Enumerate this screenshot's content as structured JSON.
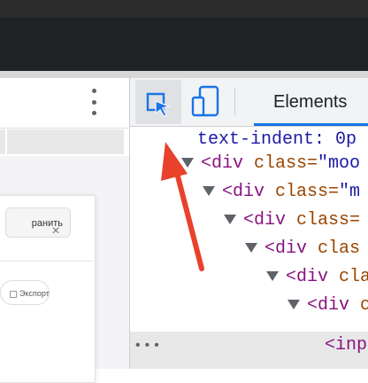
{
  "page": {
    "save_button_label": "ранить",
    "close_glyph": "×",
    "export_label": "Экспорт"
  },
  "devtools": {
    "tabs": [
      {
        "label": "Elements"
      }
    ],
    "code_lines": [
      {
        "prop": "text-indent:",
        "value": " 0p"
      },
      {
        "open": "<div",
        "attr": " class=",
        "val": "\"moo"
      },
      {
        "open": "<div",
        "attr": " class=",
        "val": "\"m"
      },
      {
        "open": "<div",
        "attr": " class=",
        "val": ""
      },
      {
        "open": "<div",
        "attr": " clas",
        "val": ""
      },
      {
        "open": "<div",
        "attr": " cla",
        "val": ""
      },
      {
        "open": "<div",
        "attr": " c",
        "val": ""
      },
      {
        "open": "<inp",
        "attr": "",
        "val": ""
      }
    ],
    "more_glyph": "•••"
  },
  "annotation": {
    "color": "#e8412c"
  },
  "colors": {
    "accent": "#1a73e8",
    "tag": "#881280",
    "attr": "#994500",
    "value": "#1a1aa6"
  }
}
